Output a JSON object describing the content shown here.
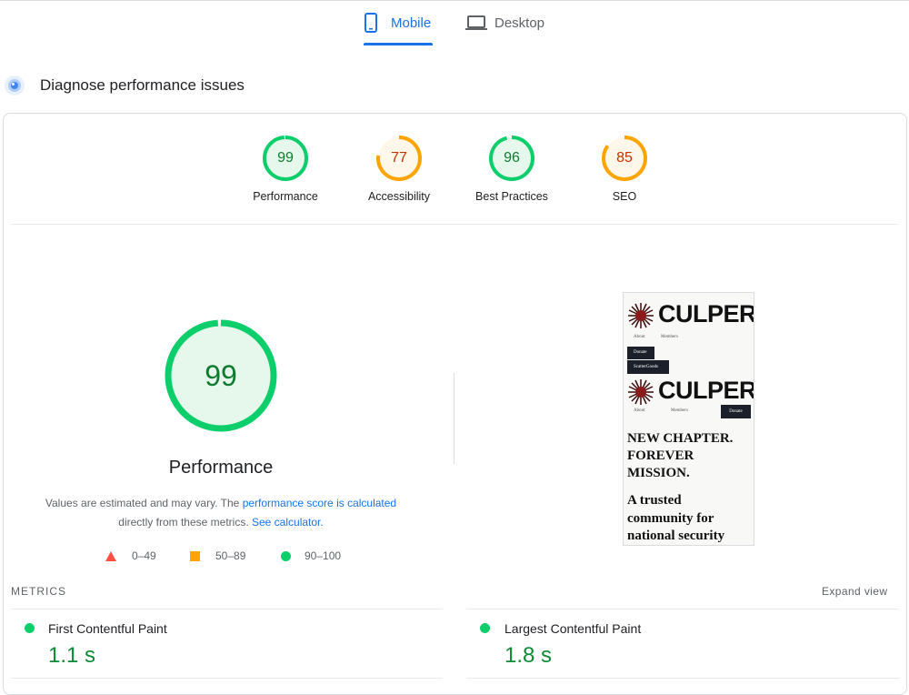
{
  "tabs": {
    "mobile": "Mobile",
    "desktop": "Desktop"
  },
  "diagnose_title": "Diagnose performance issues",
  "categories": [
    {
      "label": "Performance",
      "score": "99",
      "level": 0.99,
      "band": "pass"
    },
    {
      "label": "Accessibility",
      "score": "77",
      "level": 0.77,
      "band": "average"
    },
    {
      "label": "Best Practices",
      "score": "96",
      "level": 0.96,
      "band": "pass"
    },
    {
      "label": "SEO",
      "score": "85",
      "level": 0.85,
      "band": "average"
    }
  ],
  "performance": {
    "score": "99",
    "level": 0.99,
    "label": "Performance",
    "note_prefix": "Values are estimated and may vary. The",
    "note_link": "performance score is calculated",
    "note_middle": "directly from these metrics.",
    "note_link2": "See calculator."
  },
  "legend": {
    "fail": "0–49",
    "average": "50–89",
    "pass": "90–100"
  },
  "screenshot": {
    "brand": "CULPER",
    "nav1": "About",
    "nav2": "Members",
    "button1": "Donate",
    "button2": "ScatterGoods",
    "nav3": "About",
    "nav4": "Members",
    "button3": "Donate",
    "headline1": "NEW CHAPTER.",
    "headline2": "FOREVER",
    "headline3": "MISSION.",
    "sub1": "A trusted",
    "sub2": "community for",
    "sub3": "national security"
  },
  "metrics": {
    "title": "METRICS",
    "expand": "Expand view",
    "items": [
      {
        "name": "First Contentful Paint",
        "value": "1.1 s"
      },
      {
        "name": "Largest Contentful Paint",
        "value": "1.8 s"
      }
    ]
  },
  "colors": {
    "accent": "#1a73e8",
    "pass": "#0cce6b",
    "pass_text": "#0d7c2d",
    "average": "#ffa400",
    "average_text": "#c33300",
    "fail": "#ff4e42"
  }
}
